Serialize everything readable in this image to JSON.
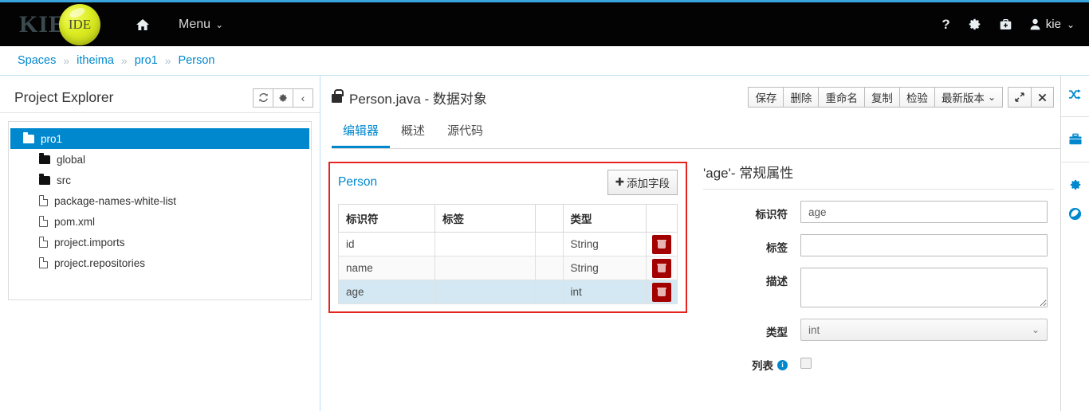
{
  "navbar": {
    "brand_kie": "KIE",
    "brand_ide": "IDE",
    "home_icon": "home-icon",
    "menu_label": "Menu",
    "help_icon": "question-mark-icon",
    "settings_icon": "gear-icon",
    "toolbox_icon": "briefcase-icon",
    "user_icon": "user-icon",
    "user_label": "kie"
  },
  "breadcrumb": {
    "separator": "»",
    "items": [
      {
        "label": "Spaces"
      },
      {
        "label": "itheima"
      },
      {
        "label": "pro1"
      },
      {
        "label": "Person"
      }
    ]
  },
  "explorer": {
    "title": "Project Explorer",
    "buttons": [
      {
        "name": "refresh-button",
        "glyph": "↻"
      },
      {
        "name": "settings-button",
        "glyph": "⚙"
      },
      {
        "name": "collapse-button",
        "glyph": "‹"
      }
    ],
    "tree": [
      {
        "label": "pro1",
        "icon": "folder-open-icon",
        "selected": true,
        "indent": false
      },
      {
        "label": "global",
        "icon": "folder-icon",
        "selected": false,
        "indent": true
      },
      {
        "label": "src",
        "icon": "folder-icon",
        "selected": false,
        "indent": true
      },
      {
        "label": "package-names-white-list",
        "icon": "file-icon",
        "selected": false,
        "indent": true
      },
      {
        "label": "pom.xml",
        "icon": "file-icon",
        "selected": false,
        "indent": true
      },
      {
        "label": "project.imports",
        "icon": "file-icon",
        "selected": false,
        "indent": true
      },
      {
        "label": "project.repositories",
        "icon": "file-icon",
        "selected": false,
        "indent": true
      }
    ]
  },
  "editor": {
    "lock_icon": "lock-icon",
    "title": "Person.java - 数据对象",
    "toolbar": {
      "save": "保存",
      "delete": "删除",
      "rename": "重命名",
      "copy": "复制",
      "validate": "检验",
      "version": "最新版本",
      "maximize_icon": "expand-icon",
      "close_icon": "close-icon"
    },
    "tabs": [
      {
        "label": "编辑器",
        "active": true
      },
      {
        "label": "概述",
        "active": false
      },
      {
        "label": "源代码",
        "active": false
      }
    ]
  },
  "data_object": {
    "name": "Person",
    "add_field_label": "添加字段",
    "add_field_glyph": "✚",
    "columns": [
      "标识符",
      "标签",
      "",
      "类型",
      ""
    ],
    "rows": [
      {
        "identifier": "id",
        "label": "",
        "extra": "",
        "type": "String",
        "delete_icon": "trash-icon",
        "selected": false
      },
      {
        "identifier": "name",
        "label": "",
        "extra": "",
        "type": "String",
        "delete_icon": "trash-icon",
        "selected": false
      },
      {
        "identifier": "age",
        "label": "",
        "extra": "",
        "type": "int",
        "delete_icon": "trash-icon",
        "selected": true
      }
    ]
  },
  "properties": {
    "title": "'age'- 常规属性",
    "identifier_label": "标识符",
    "identifier_value": "age",
    "label_label": "标签",
    "label_value": "",
    "description_label": "描述",
    "description_value": "",
    "type_label": "类型",
    "type_value": "int",
    "list_label": "列表",
    "list_info_icon": "info-icon",
    "list_checked": false
  },
  "rail": {
    "items": [
      {
        "name": "shuffle-icon"
      },
      {
        "name": "briefcase-icon"
      },
      {
        "name": "gear-icon"
      },
      {
        "name": "globe-icon"
      }
    ]
  },
  "colors": {
    "accent_blue": "#0088ce",
    "navbar_black": "#030303",
    "badge_yellow": "#dced22",
    "annotation_red": "#e52420",
    "delete_red": "#a30000",
    "row_selected": "#d3e8f3"
  }
}
